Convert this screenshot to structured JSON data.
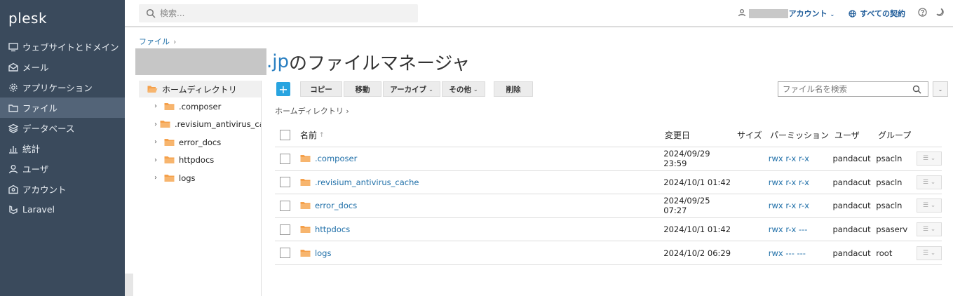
{
  "sidebar": {
    "logo": "plesk",
    "items": [
      {
        "label": "ウェブサイトとドメイン",
        "icon": "monitor-icon"
      },
      {
        "label": "メール",
        "icon": "mail-icon"
      },
      {
        "label": "アプリケーション",
        "icon": "gear-icon"
      },
      {
        "label": "ファイル",
        "icon": "folder-icon",
        "active": true
      },
      {
        "label": "データベース",
        "icon": "database-icon"
      },
      {
        "label": "統計",
        "icon": "chart-icon"
      },
      {
        "label": "ユーザ",
        "icon": "user-icon"
      },
      {
        "label": "アカウント",
        "icon": "account-icon"
      },
      {
        "label": "Laravel",
        "icon": "laravel-icon"
      }
    ]
  },
  "topbar": {
    "search_placeholder": "検索...",
    "account_label": "アカウント",
    "subscriptions_label": "すべての契約"
  },
  "main": {
    "breadcrumb": "ファイル",
    "title_domain": ".jp",
    "title_suffix": " のファイルマネージャ",
    "tree": {
      "root": "ホームディレクトリ",
      "items": [
        ".composer",
        ".revisium_antivirus_cache",
        "error_docs",
        "httpdocs",
        "logs"
      ]
    },
    "toolbar": {
      "add": "+",
      "copy": "コピー",
      "move": "移動",
      "archive": "アーカイブ",
      "other": "その他",
      "delete": "削除",
      "file_search_placeholder": "ファイル名を検索"
    },
    "path": "ホームディレクトリ",
    "table": {
      "headers": {
        "name": "名前",
        "modified": "変更日",
        "size": "サイズ",
        "permissions": "パーミッション",
        "user": "ユーザ",
        "group": "グループ"
      },
      "rows": [
        {
          "name": ".composer",
          "modified": "2024/09/29 23:59",
          "size": "",
          "permissions": "rwx r-x r-x",
          "user": "pandacut",
          "group": "psacln"
        },
        {
          "name": ".revisium_antivirus_cache",
          "modified": "2024/10/1 01:42",
          "size": "",
          "permissions": "rwx r-x r-x",
          "user": "pandacut",
          "group": "psacln"
        },
        {
          "name": "error_docs",
          "modified": "2024/09/25 07:27",
          "size": "",
          "permissions": "rwx r-x r-x",
          "user": "pandacut",
          "group": "psacln"
        },
        {
          "name": "httpdocs",
          "modified": "2024/10/1 01:42",
          "size": "",
          "permissions": "rwx r-x ---",
          "user": "pandacut",
          "group": "psaserv"
        },
        {
          "name": "logs",
          "modified": "2024/10/2 06:29",
          "size": "",
          "permissions": "rwx --- ---",
          "user": "pandacut",
          "group": "root"
        }
      ]
    }
  },
  "colors": {
    "sidebar_bg": "#3a4a5c",
    "sidebar_active": "#536478",
    "accent": "#28a4e0",
    "link": "#1f6fa8",
    "folder": "#f5a04a"
  }
}
